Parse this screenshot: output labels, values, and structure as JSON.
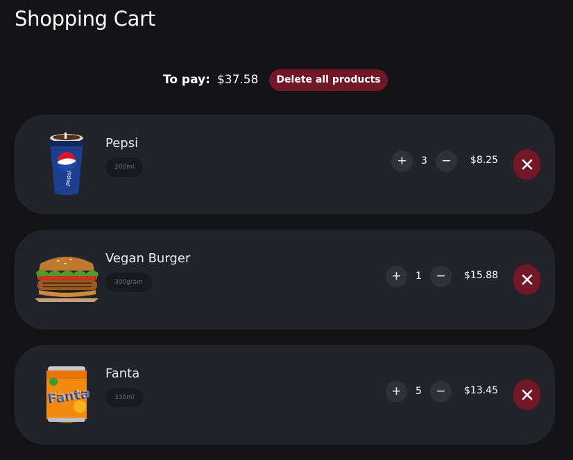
{
  "header": {
    "title": "Shopping Cart"
  },
  "summary": {
    "to_pay_label": "To pay:",
    "to_pay_value": "$37.58",
    "delete_all_label": "Delete all products"
  },
  "items": [
    {
      "name": "Pepsi",
      "size": "200ml",
      "quantity": "3",
      "price": "$8.25",
      "image_icon": "pepsi-cup-icon"
    },
    {
      "name": "Vegan Burger",
      "size": "300gram",
      "quantity": "1",
      "price": "$15.88",
      "image_icon": "burger-icon"
    },
    {
      "name": "Fanta",
      "size": "330ml",
      "quantity": "5",
      "price": "$13.45",
      "image_icon": "fanta-can-icon"
    }
  ],
  "controls": {
    "plus": "+",
    "minus": "−"
  },
  "colors": {
    "background": "#141418",
    "card": "#22232b",
    "accent": "#721726",
    "qty_button": "#30313a"
  }
}
